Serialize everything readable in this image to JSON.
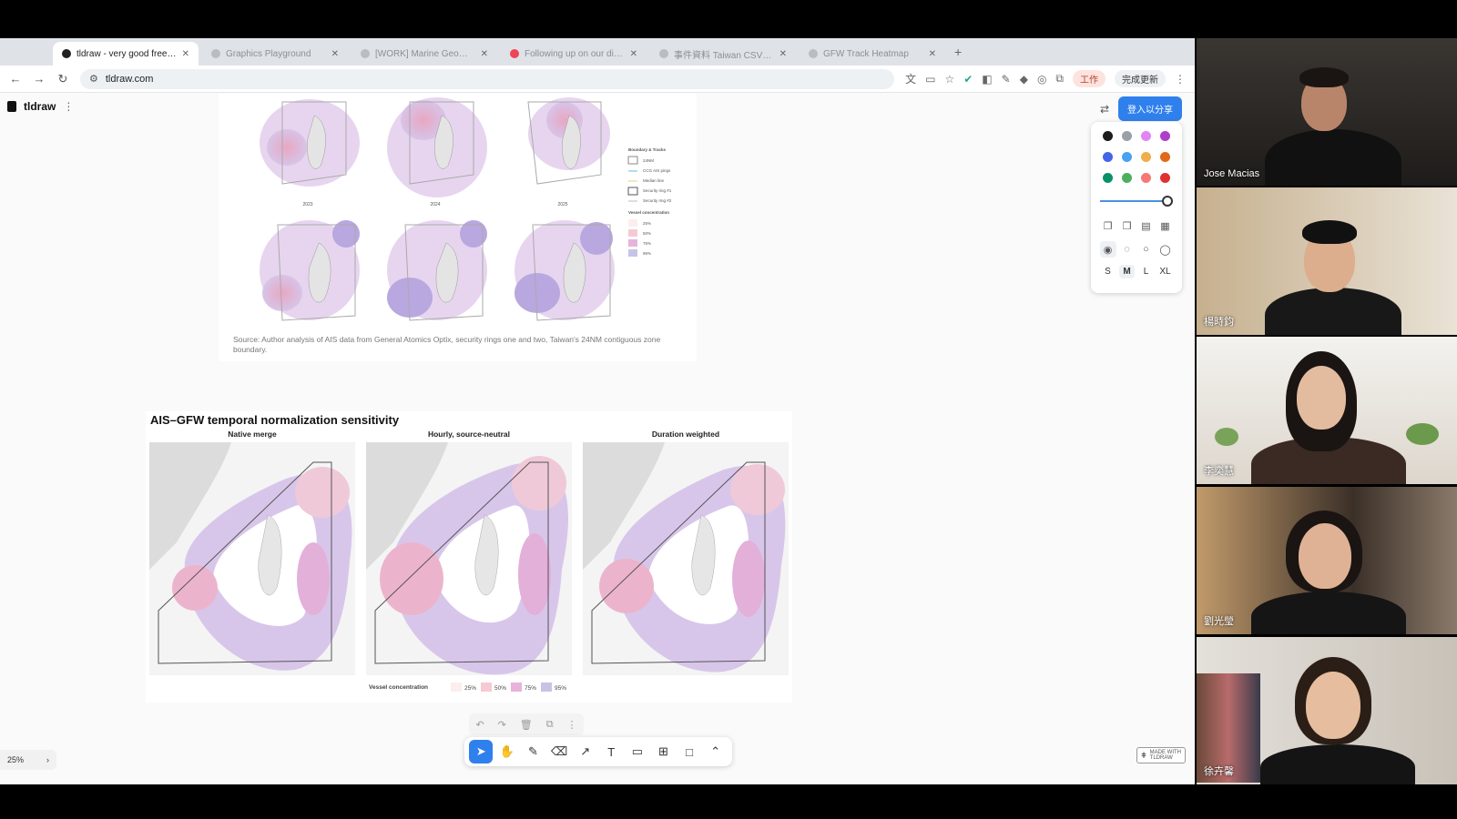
{
  "browser": {
    "tabs": [
      {
        "title": "tldraw - very good free whiteboard",
        "active": true
      },
      {
        "title": "Graphics Playground",
        "active": false
      },
      {
        "title": "[WORK] Marine Geometry",
        "active": false
      },
      {
        "title": "Following up on our discussion",
        "active": false
      },
      {
        "title": "事件資料 Taiwan CSV 02",
        "active": false
      },
      {
        "title": "GFW Track Heatmap",
        "active": false
      }
    ],
    "url": "tldraw.com",
    "profile_label": "工作",
    "update_label": "完成更新"
  },
  "tldraw": {
    "app_name": "tldraw",
    "share_button": "登入以分享",
    "zoom": "25%",
    "size_options": [
      "S",
      "M",
      "L",
      "XL"
    ],
    "selected_size": "M",
    "made_with": [
      "MADE WITH",
      "TLDRAW"
    ],
    "colors": [
      "#1d1d1d",
      "#9aa0a6",
      "#e085f4",
      "#ae3ec9",
      "#4465e9",
      "#4ba1f1",
      "#f1ac4b",
      "#e16919",
      "#099268",
      "#4cb05e",
      "#f87777",
      "#e03131"
    ],
    "tools": [
      "select",
      "hand",
      "draw",
      "eraser",
      "arrow",
      "text",
      "note",
      "asset",
      "rectangle",
      "more"
    ]
  },
  "figure1": {
    "year_labels": [
      "2023",
      "2024",
      "2025"
    ],
    "legend": {
      "title": "Boundary & Tracks",
      "items": [
        "24NM",
        "CCG AIS pings",
        "Median line",
        "Security ring #1",
        "Security ring #2"
      ],
      "conc_title": "Vessel concentration",
      "conc_items": [
        "25%",
        "50%",
        "75%",
        "95%"
      ]
    },
    "caption": "Source: Author analysis of AIS data from General Atomics Optix, security rings one and two, Taiwan's 24NM contiguous zone boundary."
  },
  "figure2": {
    "title": "AIS–GFW temporal normalization sensitivity",
    "panels": [
      "Native merge",
      "Hourly, source-neutral",
      "Duration weighted"
    ],
    "legend_label": "Vessel concentration",
    "legend_items": [
      "25%",
      "50%",
      "75%",
      "95%"
    ],
    "legend_colors": [
      "#fbeeee",
      "#f6c9d3",
      "#e7b3da",
      "#c8c3e6"
    ]
  },
  "participants": [
    {
      "name": "Jose Macias"
    },
    {
      "name": "楊時鈞"
    },
    {
      "name": "李奕慧"
    },
    {
      "name": "劉光瑩"
    },
    {
      "name": "徐卉馨"
    }
  ]
}
